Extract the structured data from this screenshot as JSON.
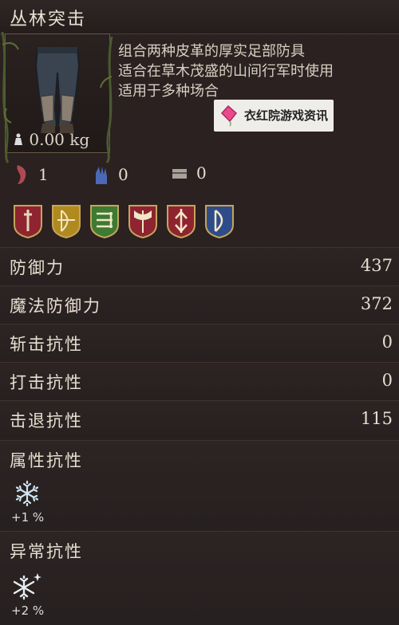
{
  "title": "丛林突击",
  "weight": "0.00 kg",
  "description": [
    "组合两种皮革的厚实足部防具",
    "适合在草木茂盛的山间行军时使用",
    "适用于多种场合"
  ],
  "watermark": "衣红院游戏资讯",
  "requirements": [
    {
      "icon": "strength-icon",
      "value": "1"
    },
    {
      "icon": "dexterity-icon",
      "value": "0"
    },
    {
      "icon": "chest-icon",
      "value": "0"
    }
  ],
  "weapon_types": [
    "sword-shield-icon",
    "bow-shield-icon",
    "crossbow-shield-icon",
    "axe-shield-icon",
    "dagger-shield-icon",
    "bow-blue-shield-icon"
  ],
  "stats": [
    {
      "label": "防御力",
      "value": "437"
    },
    {
      "label": "魔法防御力",
      "value": "372"
    },
    {
      "label": "斩击抗性",
      "value": "0"
    },
    {
      "label": "打击抗性",
      "value": "0"
    },
    {
      "label": "击退抗性",
      "value": "115"
    }
  ],
  "element_resist": {
    "label": "属性抗性",
    "icon": "snowflake-icon",
    "value": "+1 %"
  },
  "status_resist": {
    "label": "异常抗性",
    "icon": "snowflake-sparkle-icon",
    "value": "+2 %"
  }
}
